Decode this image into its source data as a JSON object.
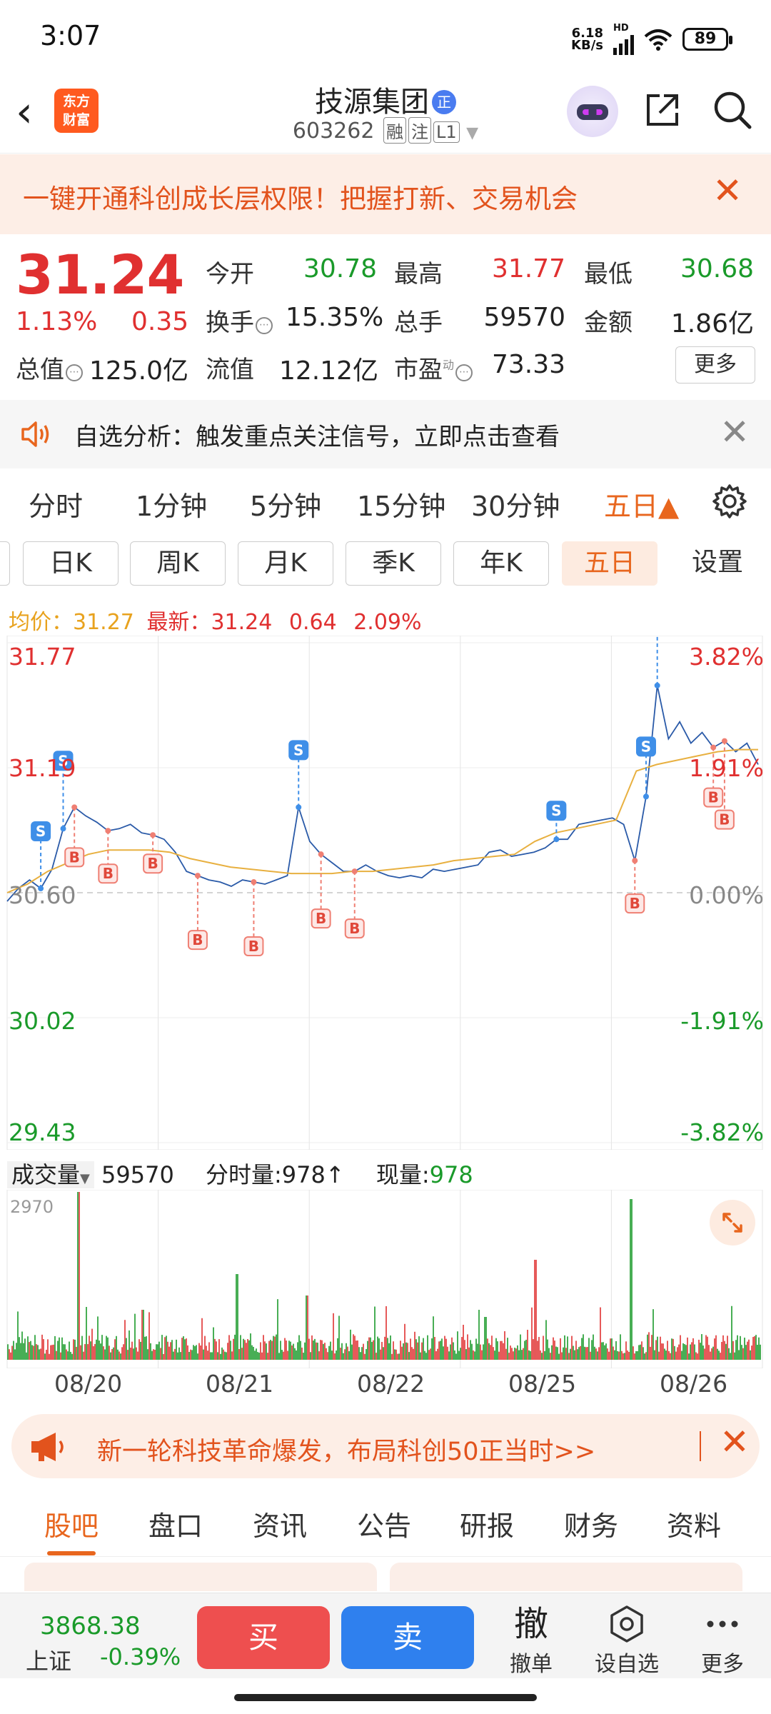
{
  "status_bar": {
    "time": "3:07",
    "net_speed_value": "6.18",
    "net_speed_unit": "KB/s",
    "net_type": "HD",
    "battery": "89"
  },
  "header": {
    "logo_line1": "东方",
    "logo_line2": "财富",
    "stock_name": "技源集团",
    "badge": "正",
    "stock_code": "603262",
    "tags": [
      "融",
      "注",
      "L1"
    ],
    "icons": [
      "back-icon",
      "robot-avatar-icon",
      "share-icon",
      "search-icon"
    ]
  },
  "promo_banner": {
    "text": "一键开通科创成长层权限！把握打新、交易机会",
    "close": "✕"
  },
  "quote": {
    "price": "31.24",
    "change_pct": "1.13%",
    "change": "0.35",
    "open_label": "今开",
    "open": "30.78",
    "high_label": "最高",
    "high": "31.77",
    "low_label": "最低",
    "low": "30.68",
    "turnover_label": "换手",
    "turnover": "15.35%",
    "volume_label": "总手",
    "volume": "59570",
    "amount_label": "金额",
    "amount": "1.86亿",
    "mktcap_label": "总值",
    "mktcap": "125.0亿",
    "float_label": "流值",
    "float": "12.12亿",
    "pe_label": "市盈",
    "pe_sup": "动",
    "pe": "73.33",
    "more": "更多"
  },
  "analysis_bar": {
    "text": "自选分析：触发重点关注信号，立即点击查看",
    "close": "✕"
  },
  "period_tabs": {
    "items": [
      "分时",
      "1分钟",
      "5分钟",
      "15分钟",
      "30分钟",
      "五日▲"
    ],
    "active_index": 5
  },
  "kline_tabs": {
    "items": [
      "日K",
      "周K",
      "月K",
      "季K",
      "年K",
      "五日",
      "设置"
    ],
    "active_index": 5
  },
  "avg_info": {
    "avg_label": "均价：",
    "avg": "31.27",
    "latest_label": "最新：",
    "latest": "31.24",
    "change": "0.64",
    "change_pct": "2.09%"
  },
  "chart_data": {
    "type": "line",
    "period": "五日",
    "x_categories": [
      "08/20",
      "08/21",
      "08/22",
      "08/25",
      "08/26"
    ],
    "y_left_ticks": [
      "31.77",
      "31.19",
      "30.60",
      "30.02",
      "29.43"
    ],
    "y_right_ticks": [
      "3.82%",
      "1.91%",
      "0.00%",
      "-1.91%",
      "-3.82%"
    ],
    "ylim": [
      29.43,
      31.77
    ],
    "prev_close": 30.6,
    "series": [
      {
        "values": [
          30.56,
          30.62,
          30.66,
          30.62,
          30.71,
          30.9,
          31.0,
          30.96,
          30.93,
          30.89,
          30.9,
          30.92,
          30.88,
          30.87,
          30.85,
          30.79,
          30.7,
          30.68,
          30.66,
          30.65,
          30.63,
          30.66,
          30.65,
          30.64,
          30.66,
          30.68,
          31.0,
          30.84,
          30.78,
          30.74,
          30.7,
          30.7,
          30.73,
          30.7,
          30.68,
          30.67,
          30.68,
          30.67,
          30.71,
          30.7,
          30.71,
          30.72,
          30.73,
          30.79,
          30.8,
          30.77,
          30.78,
          30.79,
          30.81,
          30.85,
          30.85,
          30.92,
          30.93,
          30.94,
          30.95,
          30.92,
          30.75,
          31.05,
          31.57,
          31.32,
          31.4,
          31.3,
          31.35,
          31.28,
          31.31,
          31.26,
          31.3,
          31.2
        ]
      },
      {
        "values": [
          30.6,
          30.64,
          30.7,
          30.74,
          30.78,
          30.8,
          30.8,
          30.8,
          30.79,
          30.76,
          30.74,
          30.72,
          30.71,
          30.7,
          30.69,
          30.69,
          30.69,
          30.7,
          30.7,
          30.71,
          30.72,
          30.73,
          30.75,
          30.76,
          30.77,
          30.78,
          30.84,
          30.88,
          30.9,
          30.92,
          30.94,
          31.17,
          31.2,
          31.22,
          31.24,
          31.26,
          31.27,
          31.27
        ]
      }
    ],
    "annotations": [
      "S",
      "B"
    ]
  },
  "volume_info": {
    "label": "成交量",
    "dropdown": "▼",
    "total": "59570",
    "minute_vol": "分时量:978",
    "minute_arrow": "↑",
    "current_label": "现量:",
    "current": "978",
    "scale_max": "2970",
    "expand_icon": "expand-icon"
  },
  "promo2": {
    "text": "新一轮科技革命爆发，布局科创50正当时>>",
    "close": "✕"
  },
  "bottom_tabs": {
    "items": [
      "股吧",
      "盘口",
      "资讯",
      "公告",
      "研报",
      "财务",
      "资料"
    ],
    "active_index": 0
  },
  "bottom_bar": {
    "index_value": "3868.38",
    "index_name": "上证",
    "index_pct": "-0.39%",
    "buy": "买",
    "sell": "卖",
    "cancel_big": "撤",
    "cancel_label": "撤单",
    "watch_label": "设自选",
    "more_label": "更多"
  }
}
